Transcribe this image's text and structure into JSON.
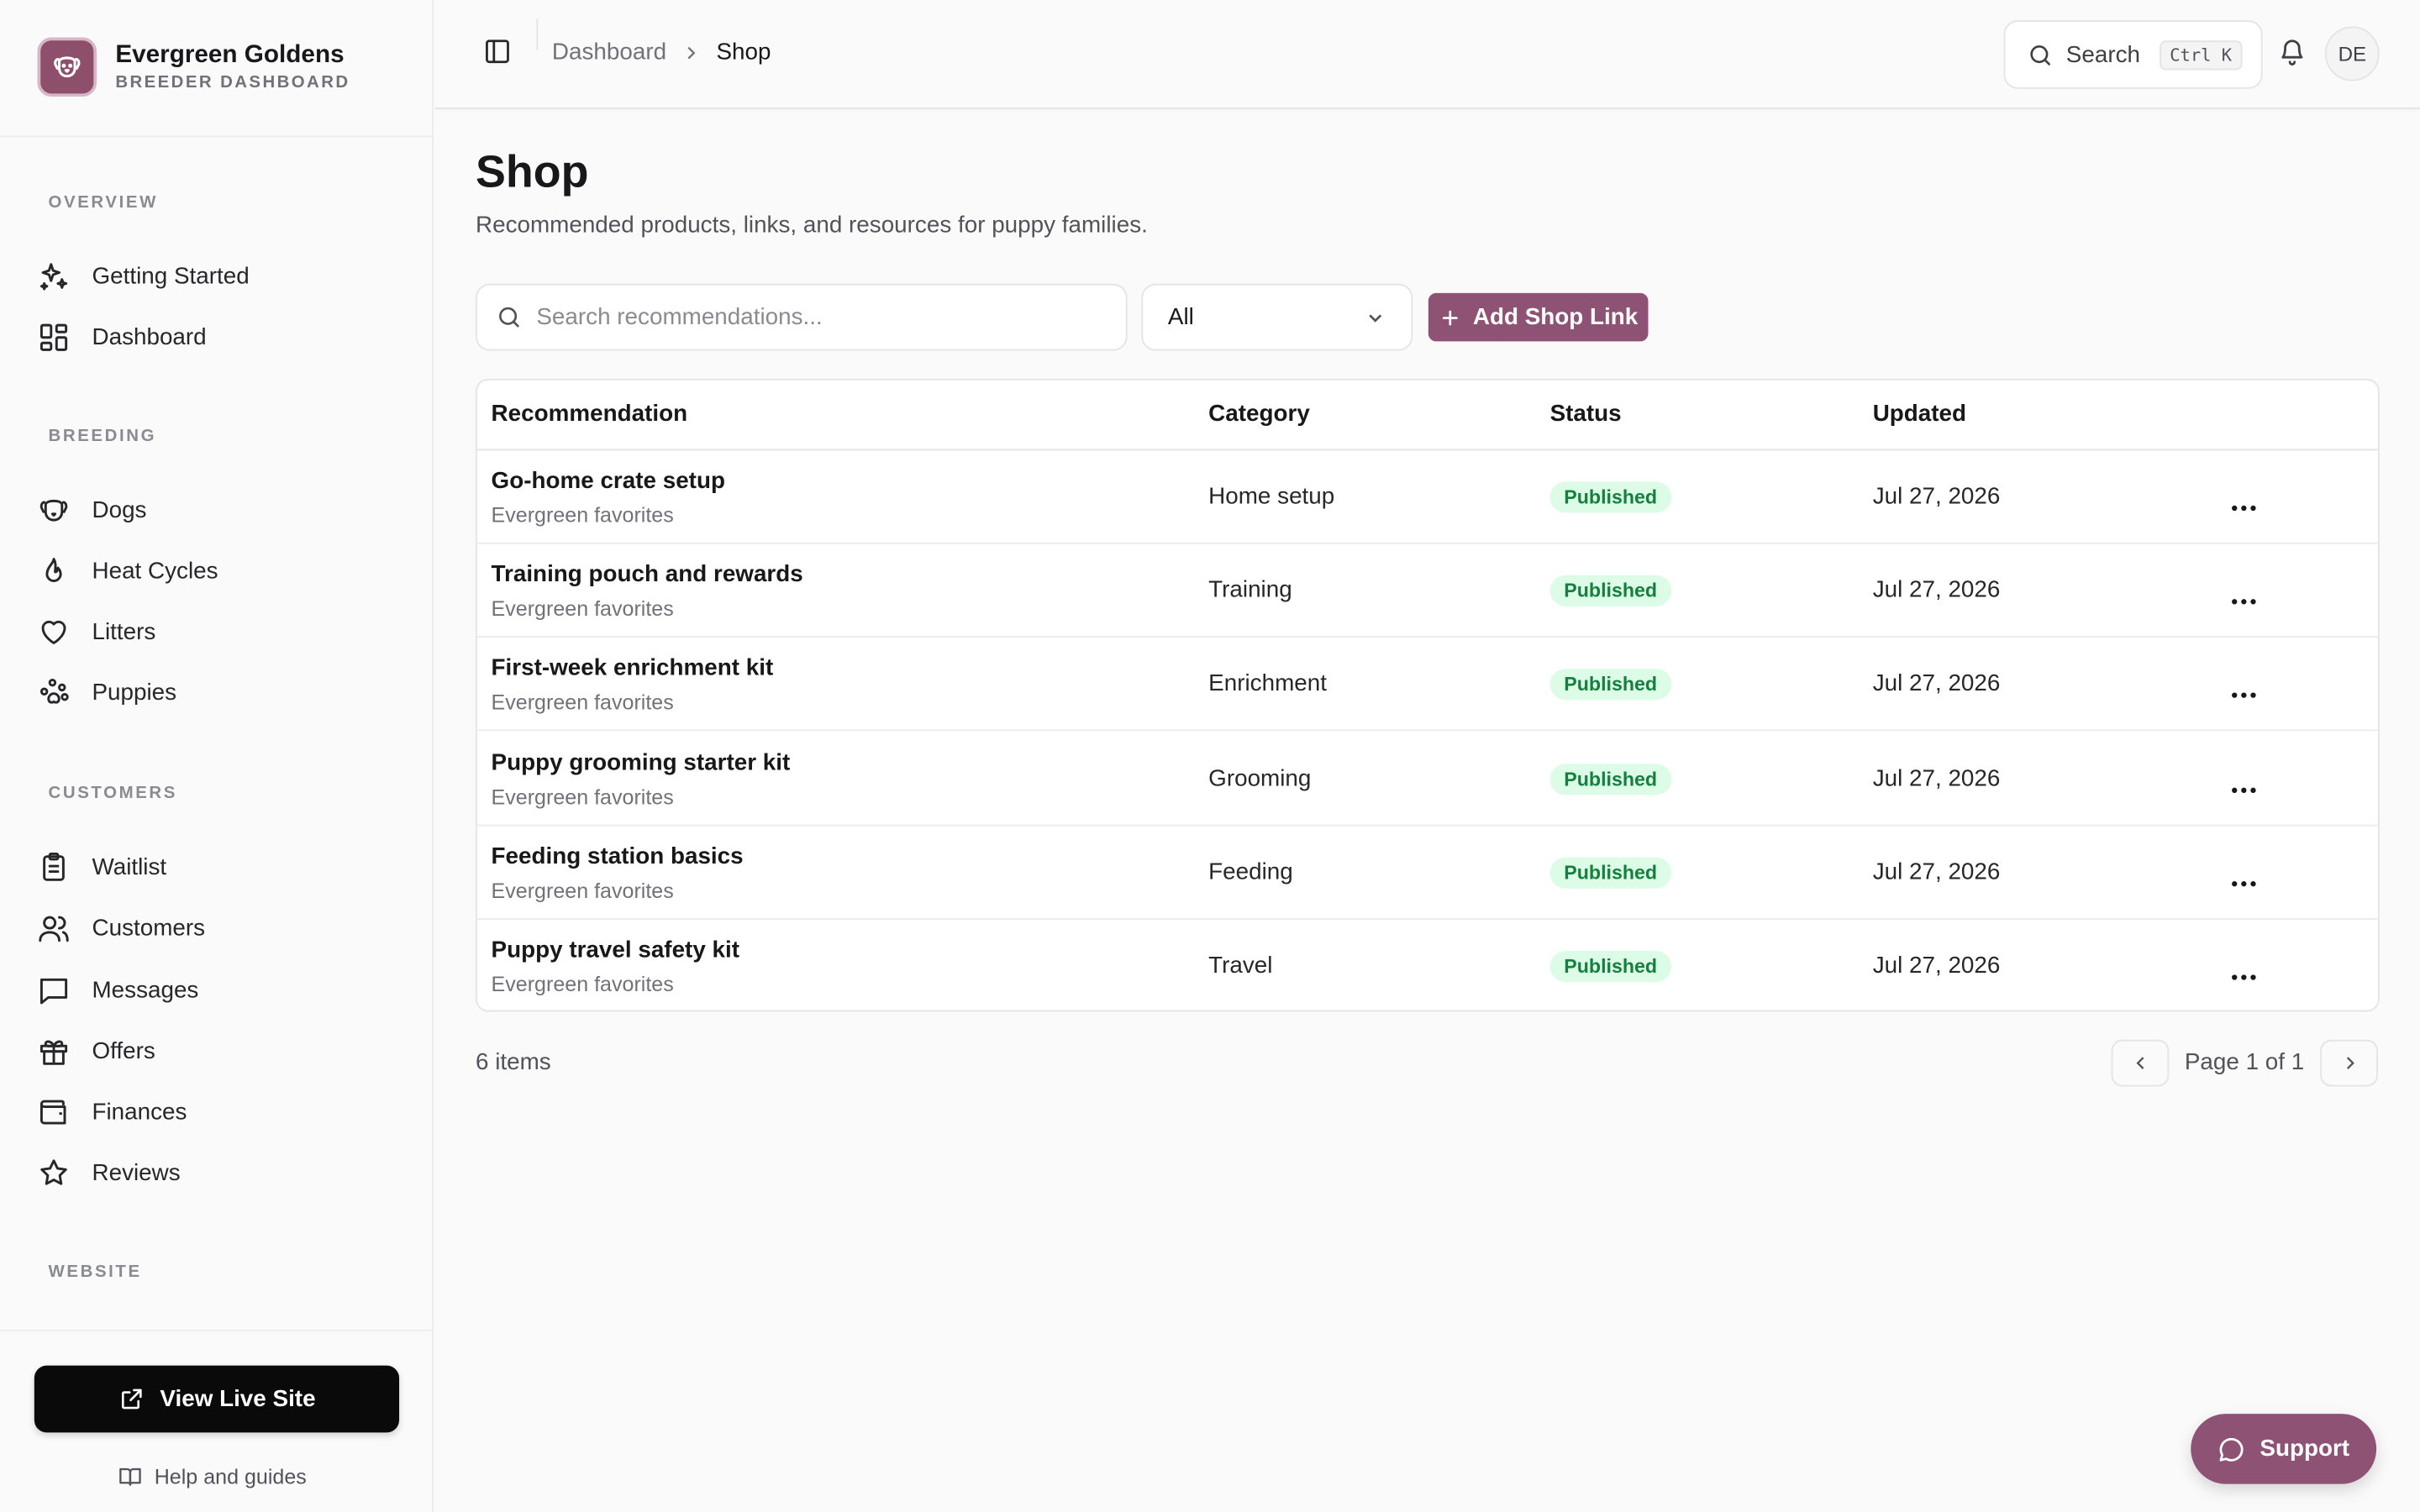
{
  "brand": {
    "title": "Evergreen Goldens",
    "subtitle": "BREEDER DASHBOARD"
  },
  "sidebar": {
    "sections": [
      {
        "label": "OVERVIEW",
        "items": [
          {
            "label": "Getting Started",
            "icon": "sparkles-icon"
          },
          {
            "label": "Dashboard",
            "icon": "grid-icon"
          }
        ]
      },
      {
        "label": "BREEDING",
        "items": [
          {
            "label": "Dogs",
            "icon": "dog-icon"
          },
          {
            "label": "Heat Cycles",
            "icon": "flame-icon"
          },
          {
            "label": "Litters",
            "icon": "heart-icon"
          },
          {
            "label": "Puppies",
            "icon": "paw-icon"
          }
        ]
      },
      {
        "label": "CUSTOMERS",
        "items": [
          {
            "label": "Waitlist",
            "icon": "clipboard-icon"
          },
          {
            "label": "Customers",
            "icon": "users-icon"
          },
          {
            "label": "Messages",
            "icon": "message-icon"
          },
          {
            "label": "Offers",
            "icon": "gift-icon"
          },
          {
            "label": "Finances",
            "icon": "wallet-icon"
          },
          {
            "label": "Reviews",
            "icon": "star-icon"
          }
        ]
      },
      {
        "label": "WEBSITE",
        "items": []
      }
    ],
    "view_live_site": "View Live Site",
    "help": "Help and guides"
  },
  "header": {
    "breadcrumb": [
      "Dashboard",
      "Shop"
    ],
    "search_label": "Search",
    "search_kbd": "Ctrl K",
    "avatar_initials": "DE"
  },
  "page": {
    "title": "Shop",
    "subtitle": "Recommended products, links, and resources for puppy families.",
    "search_placeholder": "Search recommendations...",
    "filter_value": "All",
    "add_button": "Add Shop Link"
  },
  "table": {
    "columns": [
      "Recommendation",
      "Category",
      "Status",
      "Updated"
    ],
    "rows": [
      {
        "title": "Go-home crate setup",
        "subtitle": "Evergreen favorites",
        "category": "Home setup",
        "status": "Published",
        "updated": "Jul 27, 2026"
      },
      {
        "title": "Training pouch and rewards",
        "subtitle": "Evergreen favorites",
        "category": "Training",
        "status": "Published",
        "updated": "Jul 27, 2026"
      },
      {
        "title": "First-week enrichment kit",
        "subtitle": "Evergreen favorites",
        "category": "Enrichment",
        "status": "Published",
        "updated": "Jul 27, 2026"
      },
      {
        "title": "Puppy grooming starter kit",
        "subtitle": "Evergreen favorites",
        "category": "Grooming",
        "status": "Published",
        "updated": "Jul 27, 2026"
      },
      {
        "title": "Feeding station basics",
        "subtitle": "Evergreen favorites",
        "category": "Feeding",
        "status": "Published",
        "updated": "Jul 27, 2026"
      },
      {
        "title": "Puppy travel safety kit",
        "subtitle": "Evergreen favorites",
        "category": "Travel",
        "status": "Published",
        "updated": "Jul 27, 2026"
      }
    ]
  },
  "footer": {
    "items_count": "6 items",
    "pagination": "Page 1 of 1"
  },
  "support_label": "Support",
  "colors": {
    "accent": "#8e5274",
    "badge_bg": "#dcfce7",
    "badge_text": "#15803d",
    "live_button": "#0a0a0a"
  }
}
